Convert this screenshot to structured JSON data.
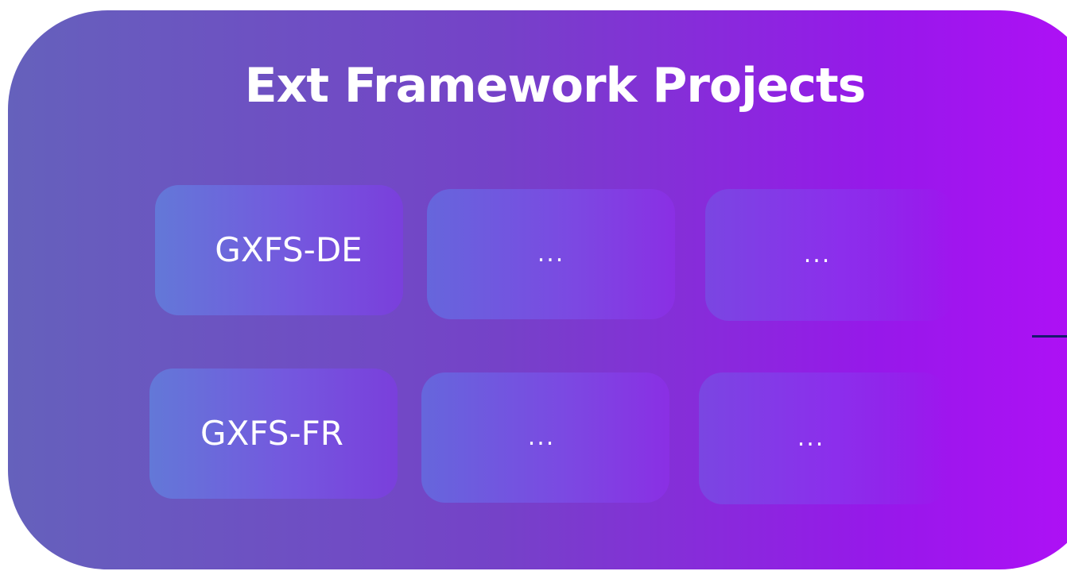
{
  "title": "Ext Framework Projects",
  "rows": [
    {
      "project": "GXFS-DE",
      "placeholders": [
        "...",
        "..."
      ]
    },
    {
      "project": "GXFS-FR",
      "placeholders": [
        "...",
        "..."
      ]
    }
  ],
  "colors": {
    "panel_gradient_start": "#6561bc",
    "panel_gradient_end": "#b10ff7",
    "text": "#ffffff",
    "connector": "#17186e"
  }
}
